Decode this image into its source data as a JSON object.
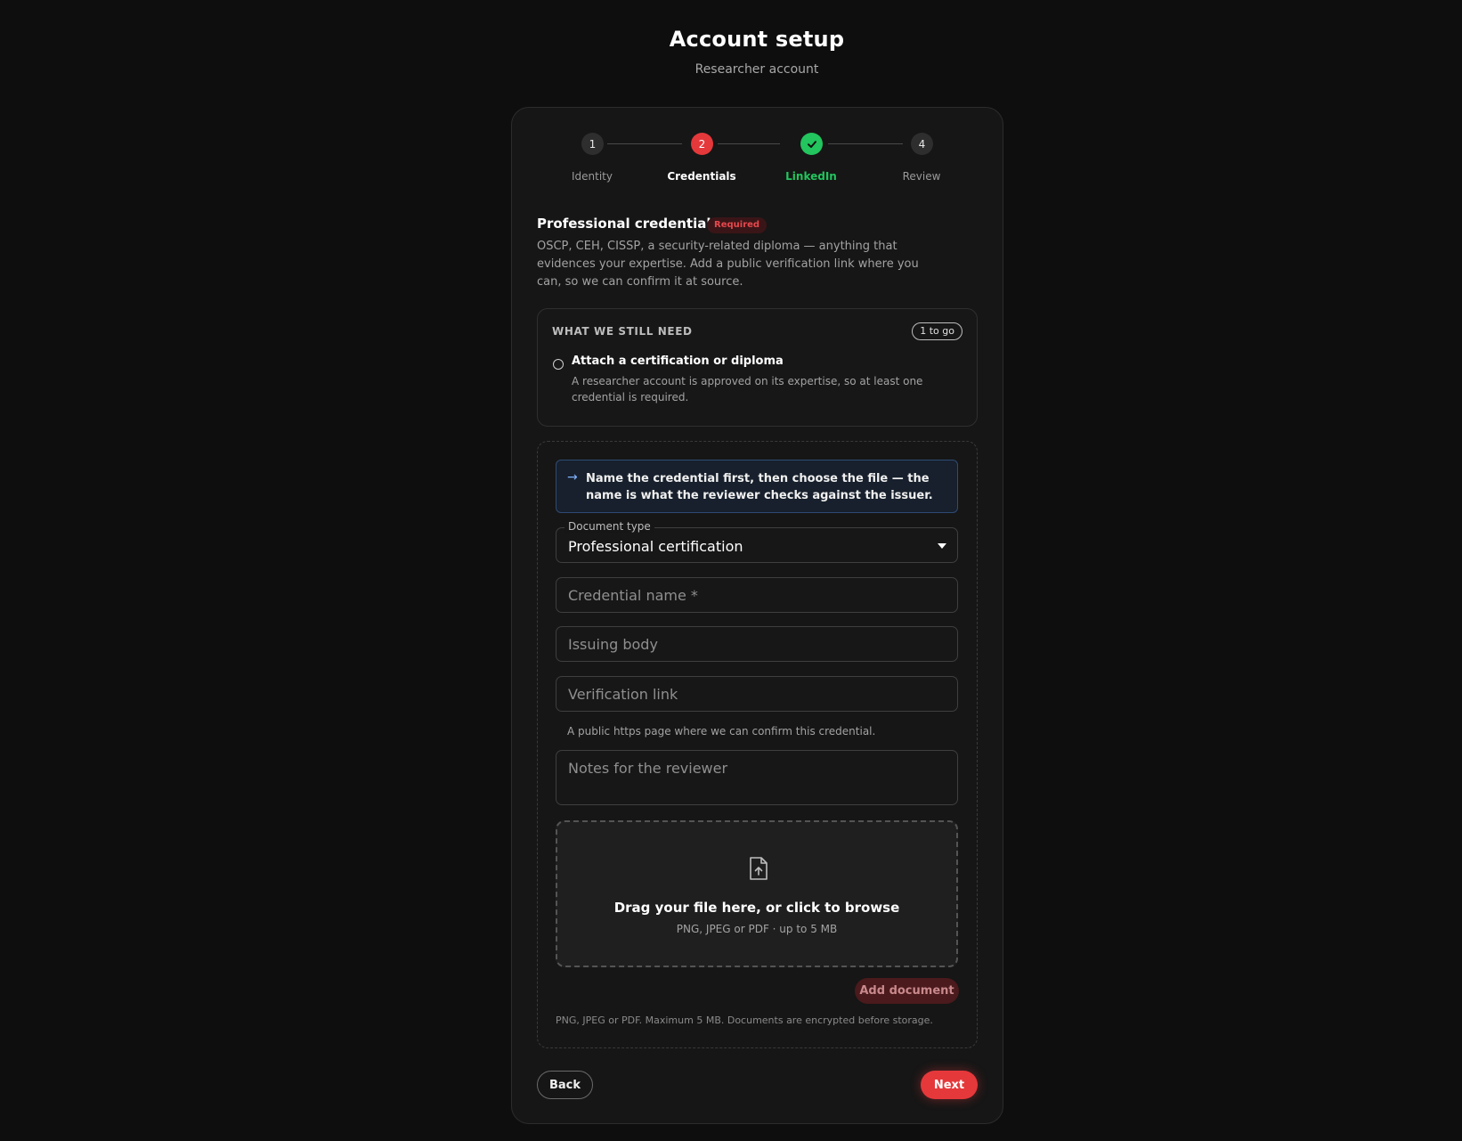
{
  "header": {
    "title": "Account setup",
    "subtitle": "Researcher account"
  },
  "stepper": {
    "steps": [
      {
        "number": "1",
        "label": "Identity",
        "state": "pending"
      },
      {
        "number": "2",
        "label": "Credentials",
        "state": "active"
      },
      {
        "number": "",
        "label": "LinkedIn",
        "state": "done"
      },
      {
        "number": "4",
        "label": "Review",
        "state": "pending"
      }
    ]
  },
  "section": {
    "title": "Professional credentials",
    "badge": "Required",
    "description": "OSCP, CEH, CISSP, a security-related diploma — anything that evidences your expertise. Add a public verification link where you can, so we can confirm it at source."
  },
  "needs": {
    "heading": "WHAT WE STILL NEED",
    "count_badge": "1 to go",
    "items": [
      {
        "title": "Attach a certification or diploma",
        "description": "A researcher account is approved on its expertise, so at least one credential is required."
      }
    ]
  },
  "form": {
    "hint": "Name the credential first, then choose the file — the name is what the reviewer checks against the issuer.",
    "document_type": {
      "legend": "Document type",
      "value": "Professional certification"
    },
    "credential_name": {
      "placeholder": "Credential name *"
    },
    "issuing_body": {
      "placeholder": "Issuing body"
    },
    "verification_link": {
      "placeholder": "Verification link",
      "helper": "A public https page where we can confirm this credential."
    },
    "notes": {
      "placeholder": "Notes for the reviewer"
    },
    "dropzone": {
      "title": "Drag your file here, or click to browse",
      "subtitle": "PNG, JPEG or PDF · up to 5 MB"
    },
    "add_document_label": "Add document",
    "footnote": "PNG, JPEG or PDF. Maximum 5 MB. Documents are encrypted before storage."
  },
  "nav": {
    "back_label": "Back",
    "next_label": "Next"
  },
  "colors": {
    "accent": "#e5383b",
    "success": "#22c55e",
    "background": "#0e0e0e",
    "card": "#161616"
  },
  "icons": {
    "hint": "arrow-right-icon",
    "step_done": "check-icon",
    "upload": "file-upload-icon",
    "select": "caret-down-icon"
  }
}
